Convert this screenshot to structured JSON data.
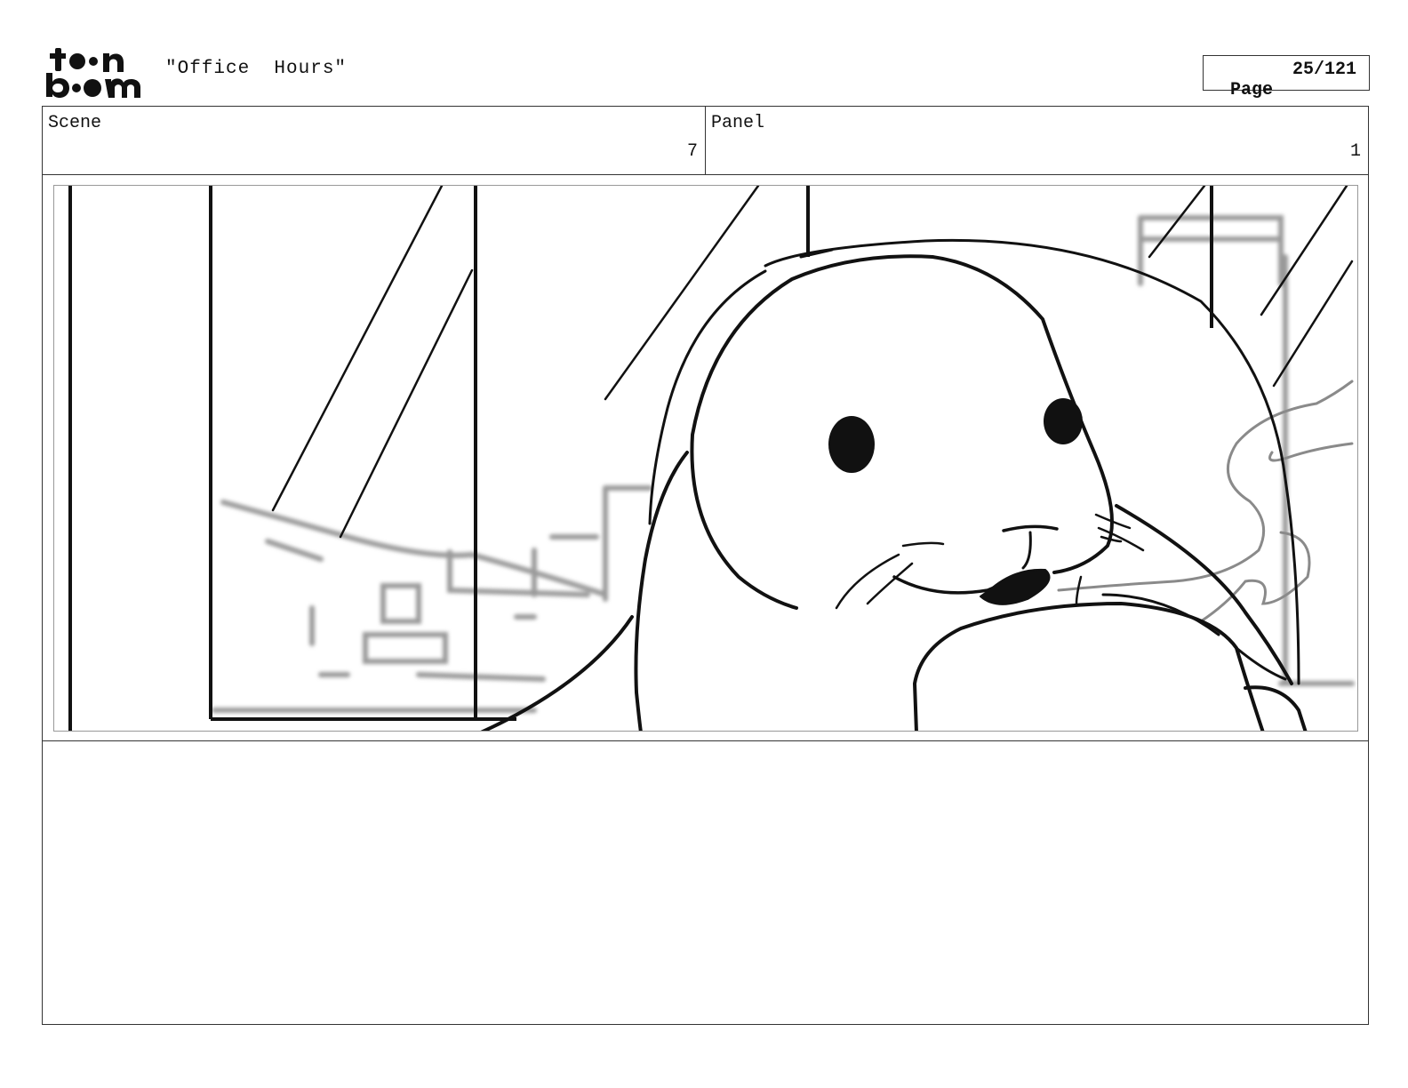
{
  "header": {
    "logo_text": "toon boom",
    "title": "\"Office  Hours\"",
    "page_label": "Page",
    "page_number": "25/121"
  },
  "info": {
    "scene_label": "Scene",
    "scene_value": "7",
    "panel_label": "Panel",
    "panel_value": "1"
  },
  "notes": {
    "text": ""
  }
}
